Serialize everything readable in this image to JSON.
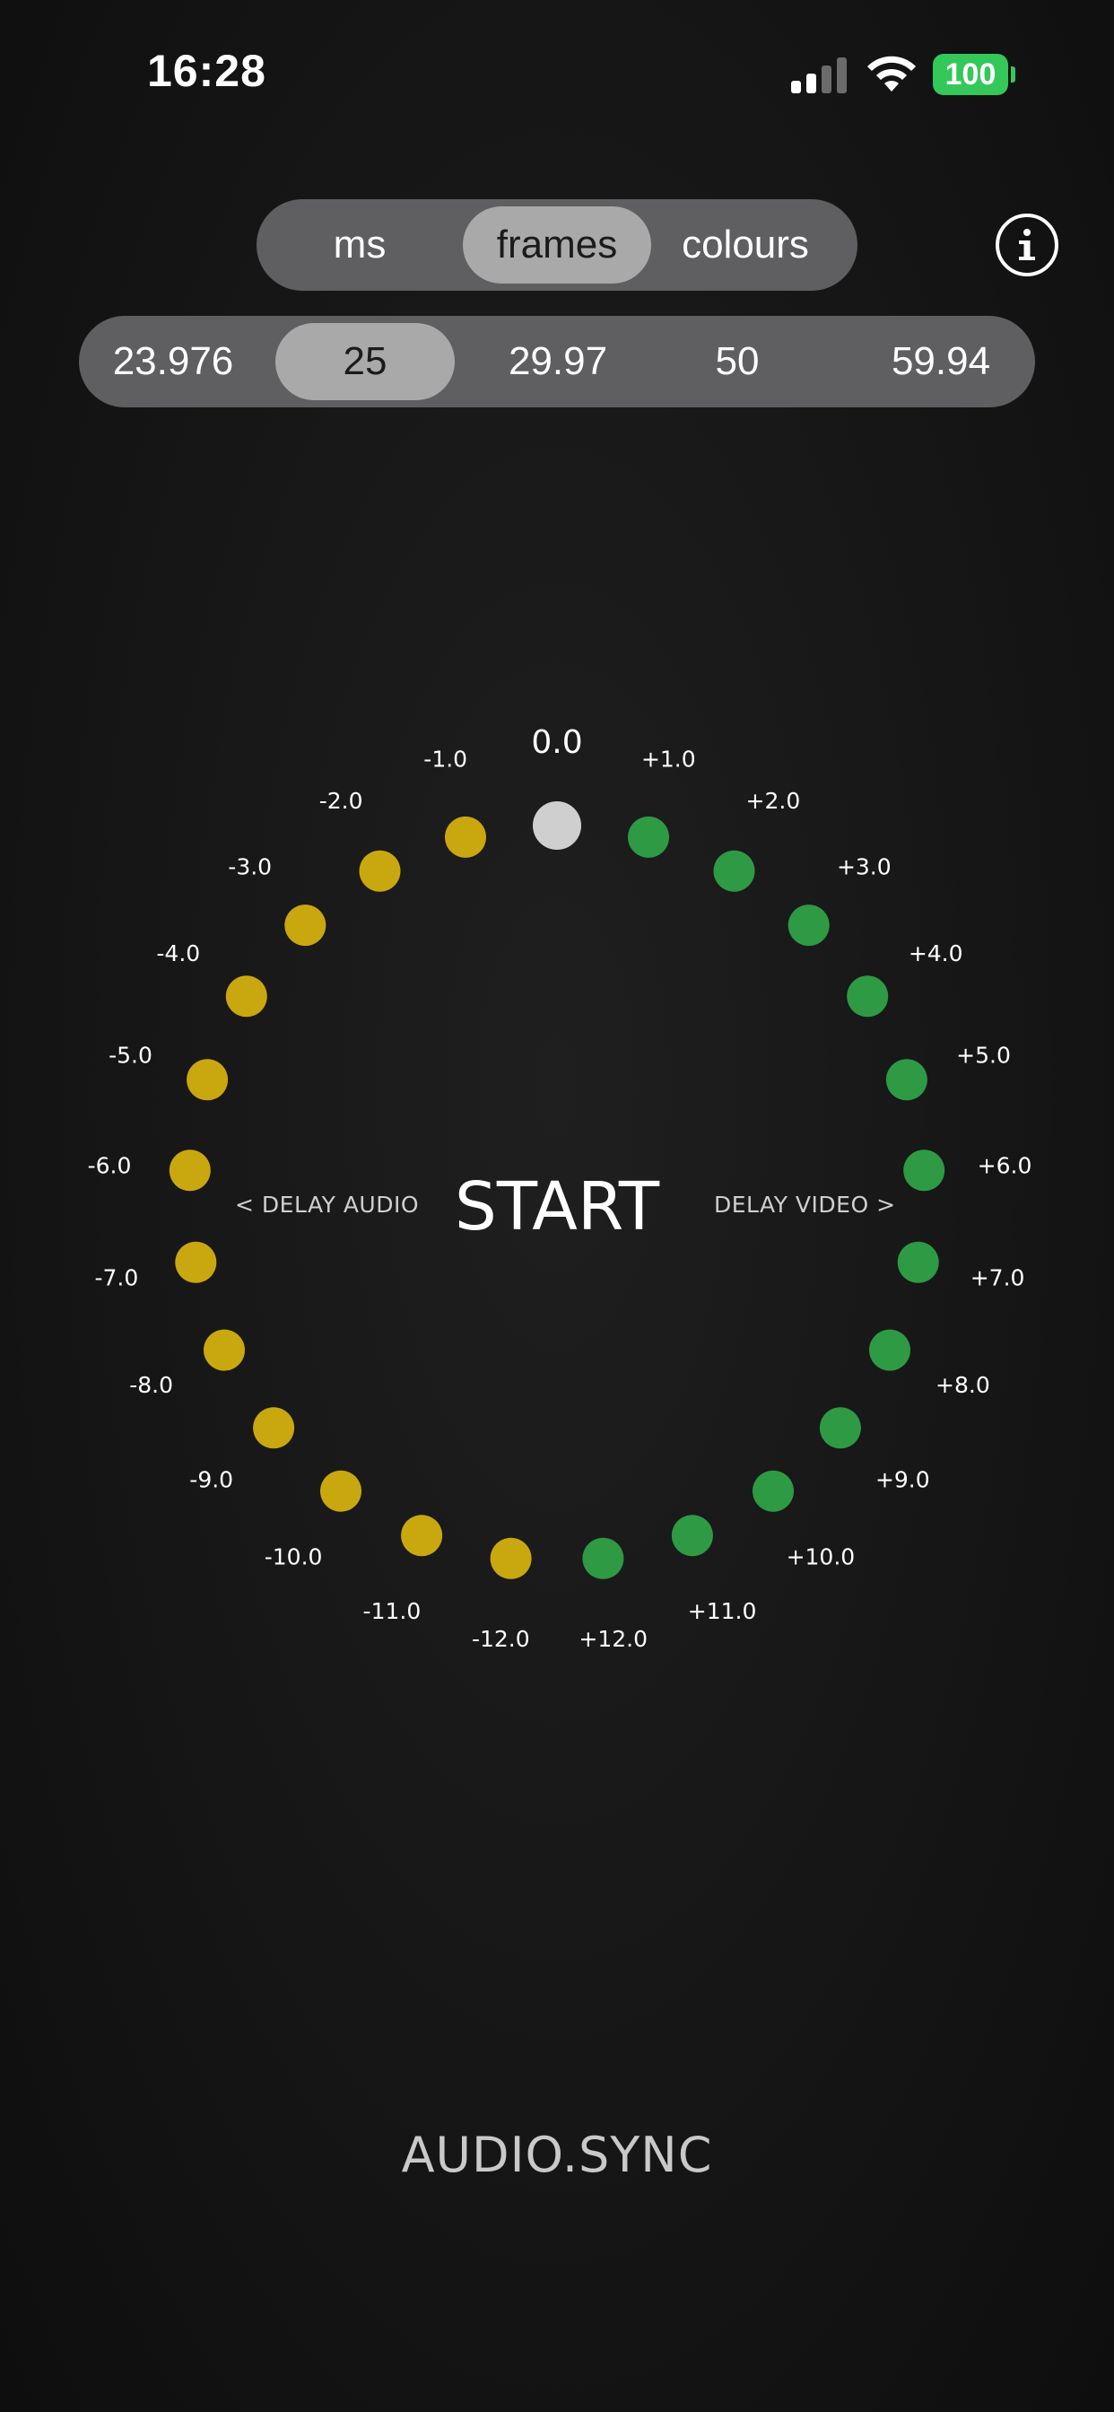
{
  "status_bar": {
    "time": "16:28",
    "battery": "100"
  },
  "mode_selector": {
    "options": [
      "ms",
      "frames",
      "colours"
    ],
    "selected": "frames"
  },
  "fps_selector": {
    "options": [
      "23.976",
      "25",
      "29.97",
      "50",
      "59.94"
    ],
    "selected": "25"
  },
  "dial": {
    "center_label": "0.0",
    "markers": [
      {
        "label": "0.0",
        "color": "#cfcfcf"
      },
      {
        "label": "+1.0",
        "color": "#2e9a44"
      },
      {
        "label": "+2.0",
        "color": "#2e9a44"
      },
      {
        "label": "+3.0",
        "color": "#2e9a44"
      },
      {
        "label": "+4.0",
        "color": "#2e9a44"
      },
      {
        "label": "+5.0",
        "color": "#2e9a44"
      },
      {
        "label": "+6.0",
        "color": "#2e9a44"
      },
      {
        "label": "+7.0",
        "color": "#2e9a44"
      },
      {
        "label": "+8.0",
        "color": "#2e9a44"
      },
      {
        "label": "+9.0",
        "color": "#2e9a44"
      },
      {
        "label": "+10.0",
        "color": "#2e9a44"
      },
      {
        "label": "+11.0",
        "color": "#2e9a44"
      },
      {
        "label": "+12.0",
        "color": "#2e9a44"
      },
      {
        "label": "-12.0",
        "color": "#c9a70f"
      },
      {
        "label": "-11.0",
        "color": "#c9a70f"
      },
      {
        "label": "-10.0",
        "color": "#c9a70f"
      },
      {
        "label": "-9.0",
        "color": "#c9a70f"
      },
      {
        "label": "-8.0",
        "color": "#c9a70f"
      },
      {
        "label": "-7.0",
        "color": "#c9a70f"
      },
      {
        "label": "-6.0",
        "color": "#c9a70f"
      },
      {
        "label": "-5.0",
        "color": "#c9a70f"
      },
      {
        "label": "-4.0",
        "color": "#c9a70f"
      },
      {
        "label": "-3.0",
        "color": "#c9a70f"
      },
      {
        "label": "-2.0",
        "color": "#c9a70f"
      },
      {
        "label": "-1.0",
        "color": "#c9a70f"
      }
    ]
  },
  "labels": {
    "delay_audio": "< DELAY AUDIO",
    "delay_video": "DELAY VIDEO >",
    "start": "START",
    "brand": "AUDIO.SYNC"
  },
  "colors": {
    "audio": "#c9a70f",
    "video": "#2e9a44",
    "neutral": "#cfcfcf",
    "segment_bg": "#5f5f61",
    "segment_selected": "#a9a9aa"
  }
}
